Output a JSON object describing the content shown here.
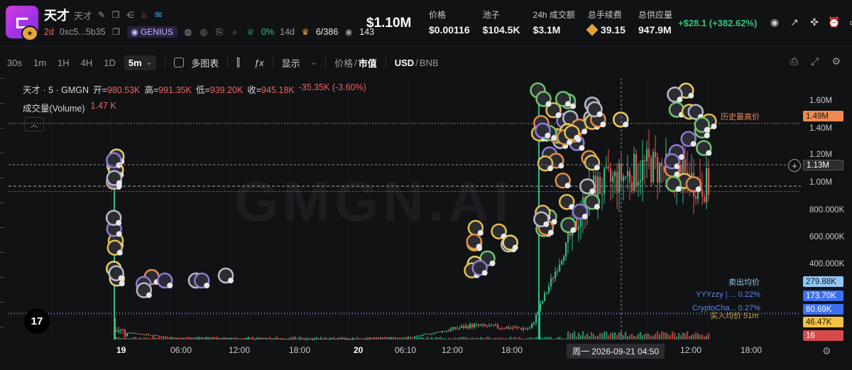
{
  "header": {
    "name": "天才",
    "subname": "天才",
    "age": "2d",
    "address": "0xc5...5b35",
    "tag": "GENIUS",
    "pct_top": "0%",
    "holders_days": "14d",
    "insiders": "6/386",
    "watchers": "143",
    "market_cap": "$1.10M",
    "pnl": "+$28.1 (+382.62%)"
  },
  "stats": [
    {
      "label": "价格",
      "value": "$0.00116"
    },
    {
      "label": "池子",
      "value": "$104.5K"
    },
    {
      "label": "24h 成交额",
      "value": "$3.1M"
    },
    {
      "label": "总手续费",
      "value": "39.15"
    },
    {
      "label": "总供应量",
      "value": "947.9M"
    }
  ],
  "toolbar": {
    "timeframes": [
      "30s",
      "1m",
      "1H",
      "4H",
      "1D"
    ],
    "active_timeframe": "5m",
    "multi_chart": "多图表",
    "display": "显示",
    "price": "价格",
    "slash": "/",
    "mcap": "市值",
    "usd": "USD",
    "bnb": "BNB"
  },
  "legend": {
    "symbol": "天才 · 5 · GMGN",
    "open_label": "开=",
    "open": "980.53K",
    "high_label": "高=",
    "high": "991.35K",
    "low_label": "低=",
    "low": "939.20K",
    "close_label": "收=",
    "close": "945.18K",
    "change": "-35.35K (-3.60%)",
    "volume_label": "成交量(Volume)",
    "volume": "1.47 K"
  },
  "watermark": "GMGN.AI",
  "y_axis": [
    "1.60M",
    "1.40M",
    "1.20M",
    "1.00M",
    "800.000K",
    "600.000K",
    "400.000K"
  ],
  "x_axis": [
    "19",
    "06:00",
    "12:00",
    "18:00",
    "20",
    "06:10",
    "12:00",
    "18:00",
    "12:00",
    "18:00"
  ],
  "crosshair_time": "周一 2026-09-21   04:50",
  "price_tags": {
    "ath": "1.49M",
    "current": "1.13M",
    "sell_avg": "279.88K",
    "yyy": "173.70K",
    "crypto": "80.69K",
    "buy_avg": "46.47K",
    "vol": "16"
  },
  "annotations": {
    "ath_label": "历史最高价",
    "sell_avg_label": "卖出均价",
    "yyy_label": "YYYzzy | ... 0.22%",
    "crypto_label": "CryptoCha... 0.27%",
    "buy_avg_label": "买入均价 51m"
  },
  "colors": {
    "up": "#2ebd85",
    "down": "#f04a4a",
    "ath": "#f08a50",
    "current": "#2a2c31",
    "sell_avg": "#8fc8f4",
    "yyy": "#3d6ff2",
    "crypto": "#3d6ff2",
    "buy_avg": "#f5c242",
    "vol": "#d64a4a"
  },
  "chart_data": {
    "type": "candlestick",
    "unit": "market cap (USD)",
    "ylim": [
      250000,
      1750000
    ],
    "x": [
      "19 00:00",
      "19 06:00",
      "19 12:00",
      "19 18:00",
      "20 00:00",
      "20 06:10",
      "20 12:00",
      "20 18:00",
      "21 00:00",
      "21 06:00",
      "21 12:00"
    ],
    "close": [
      300000,
      258000,
      255000,
      252000,
      253000,
      262000,
      330000,
      310000,
      1100000,
      1250000,
      1130000
    ]
  }
}
